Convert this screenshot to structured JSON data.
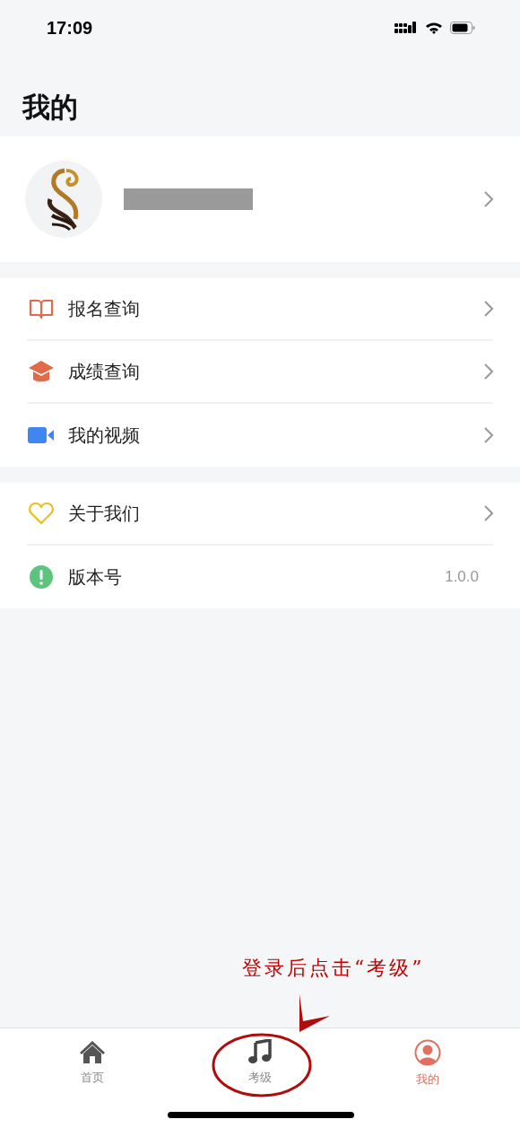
{
  "status_bar": {
    "time": "17:09"
  },
  "header": {
    "title": "我的"
  },
  "menu_groups": [
    {
      "items": [
        {
          "label": "报名查询",
          "kind": "link"
        },
        {
          "label": "成绩查询",
          "kind": "link"
        },
        {
          "label": "我的视频",
          "kind": "link"
        }
      ]
    },
    {
      "items": [
        {
          "label": "关于我们",
          "kind": "link"
        },
        {
          "label": "版本号",
          "kind": "value",
          "value": "1.0.0"
        }
      ]
    }
  ],
  "annotation": {
    "text": "登录后点击“考级”"
  },
  "tab_bar": [
    {
      "label": "首页",
      "selected": false
    },
    {
      "label": "考级",
      "selected": false
    },
    {
      "label": "我的",
      "selected": true
    }
  ]
}
